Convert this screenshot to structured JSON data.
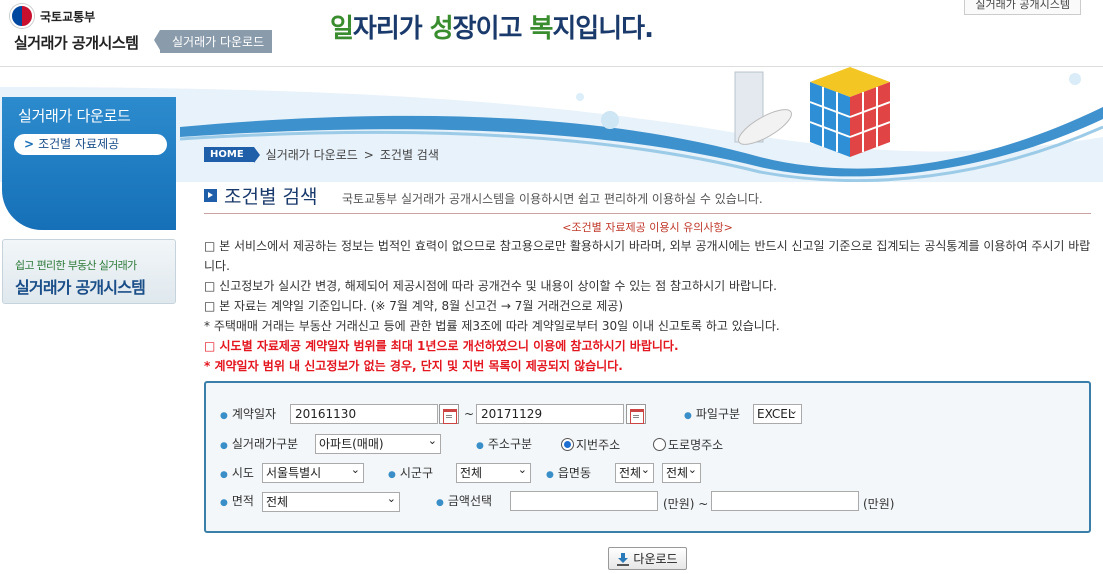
{
  "header": {
    "ministry": "국토교통부",
    "system_name": "실거래가 공개시스템",
    "download_tag": "실거래가 다운로드",
    "slogan_p1": "일",
    "slogan_p2": "자리가 ",
    "slogan_p3": "성",
    "slogan_p4": "장이고 ",
    "slogan_p5": "복",
    "slogan_p6": "지입니다.",
    "top_link": "실거래가 공개시스템"
  },
  "sidebar": {
    "title": "실거래가 다운로드",
    "item_chevron": ">",
    "item_label": "조건별 자료제공",
    "ad_sub": "쉽고 편리한 부동산 실거래가",
    "ad_main": "실거래가 공개시스템"
  },
  "breadcrumb": {
    "home": "HOME",
    "level1": "실거래가 다운로드",
    "sep": ">",
    "level2": "조건별 검색"
  },
  "page": {
    "title": "조건별 검색",
    "description": "국토교통부 실거래가 공개시스템을 이용하시면 쉽고 편리하게 이용하실 수 있습니다."
  },
  "notices": {
    "heading": "<조건별 자료제공 이용시 유의사항>",
    "lines": [
      "□ 본 서비스에서 제공하는 정보는 법적인 효력이 없으므로 참고용으로만 활용하시기 바라며, 외부 공개시에는 반드시 신고일 기준으로 집계되는 공식통계를 이용하여 주시기 바랍니다.",
      "□ 신고정보가 실시간 변경, 해제되어 제공시점에 따라 공개건수 및 내용이 상이할 수 있는 점 참고하시기 바랍니다.",
      "□ 본 자료는 계약일 기준입니다. (※ 7월 계약, 8월 신고건 → 7월 거래건으로 제공)",
      "* 주택매매 거래는 부동산 거래신고 등에 관한 법률 제3조에 따라 계약일로부터 30일 이내 신고토록 하고 있습니다.",
      "□ 시도별 자료제공 계약일자 범위를 최대 1년으로 개선하였으니 이용에 참고하시기 바랍니다.",
      "* 계약일자 범위 내 신고정보가 없는 경우, 단지 및 지번 목록이 제공되지 않습니다."
    ]
  },
  "form": {
    "bullet": "●",
    "contract_date_label": "계약일자",
    "date_from": "20161130",
    "tilde": "~",
    "date_to": "20171129",
    "file_type_label": "파일구분",
    "file_type": "EXCEL",
    "deal_type_label": "실거래가구분",
    "deal_type": "아파트(매매)",
    "address_type_label": "주소구분",
    "address_opt1": "지번주소",
    "address_opt2": "도로명주소",
    "sido_label": "시도",
    "sido": "서울특별시",
    "sigungu_label": "시군구",
    "sigungu": "전체",
    "dong_label": "읍면동",
    "dong1": "전체",
    "dong2": "전체",
    "area_label": "면적",
    "area": "전체",
    "amount_label": "금액선택",
    "amount_from": "",
    "unit1": "(만원) ~",
    "amount_to": "",
    "unit2": "(만원)"
  },
  "download_button": "다운로드",
  "colors": {
    "primary_blue": "#1f5ea8",
    "sidebar_blue": "#1670b8",
    "slogan_green": "#3a8d2e",
    "notice_red": "#e4161f"
  }
}
